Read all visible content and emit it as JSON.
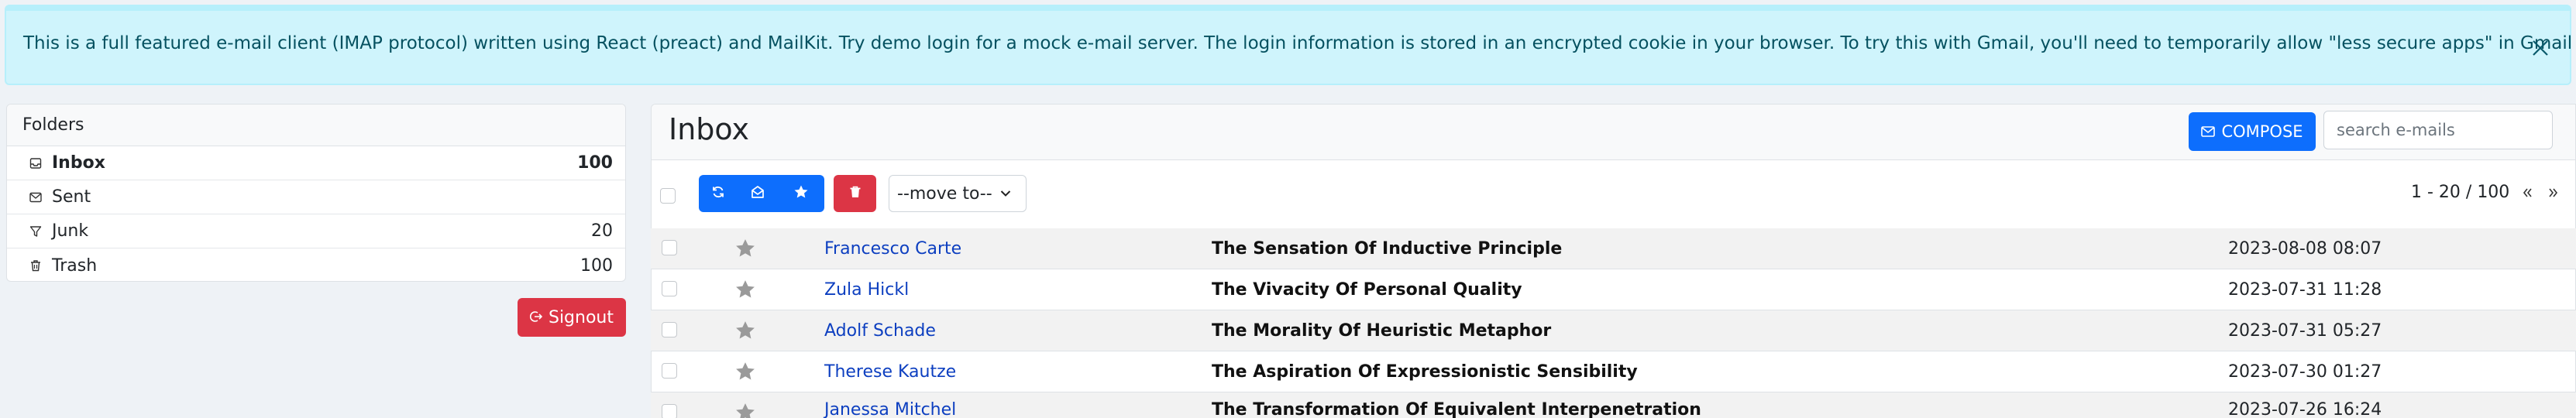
{
  "alert": {
    "text": "This is a full featured e-mail client (IMAP protocol) written using React (preact) and MailKit. Try demo login for a mock e-mail server. The login information is stored in an encrypted cookie in your browser. To try this with Gmail, you'll need to temporarily allow \"less secure apps\" in Gmail settings."
  },
  "folders": {
    "title": "Folders",
    "items": [
      {
        "label": "Inbox",
        "count": "100",
        "icon": "inbox-icon"
      },
      {
        "label": "Sent",
        "count": "",
        "icon": "envelope-icon"
      },
      {
        "label": "Junk",
        "count": "20",
        "icon": "filter-icon"
      },
      {
        "label": "Trash",
        "count": "100",
        "icon": "trash-icon"
      }
    ]
  },
  "signout": {
    "label": "Signout"
  },
  "main": {
    "title": "Inbox",
    "compose_label": "COMPOSE",
    "search_placeholder": "search e-mails",
    "move_to": "--move to--",
    "pager": "1 - 20 / 100"
  },
  "emails": [
    {
      "from": "Francesco Carte",
      "subject": "The Sensation Of Inductive Principle",
      "date": "2023-08-08 08:07"
    },
    {
      "from": "Zula Hickl",
      "subject": "The Vivacity Of Personal Quality",
      "date": "2023-07-31 11:28"
    },
    {
      "from": "Adolf Schade",
      "subject": "The Morality Of Heuristic Metaphor",
      "date": "2023-07-31 05:27"
    },
    {
      "from": "Therese Kautze",
      "subject": "The Aspiration Of Expressionistic Sensibility",
      "date": "2023-07-30 01:27"
    },
    {
      "from": "Janessa Mitchel",
      "subject": "The Transformation Of Equivalent Interpenetration",
      "date": "2023-07-26 16:24"
    }
  ],
  "colors": {
    "primary": "#0d6efd",
    "danger": "#dc3545",
    "alert_bg": "#cff4fc",
    "link": "#0d3fc0"
  }
}
